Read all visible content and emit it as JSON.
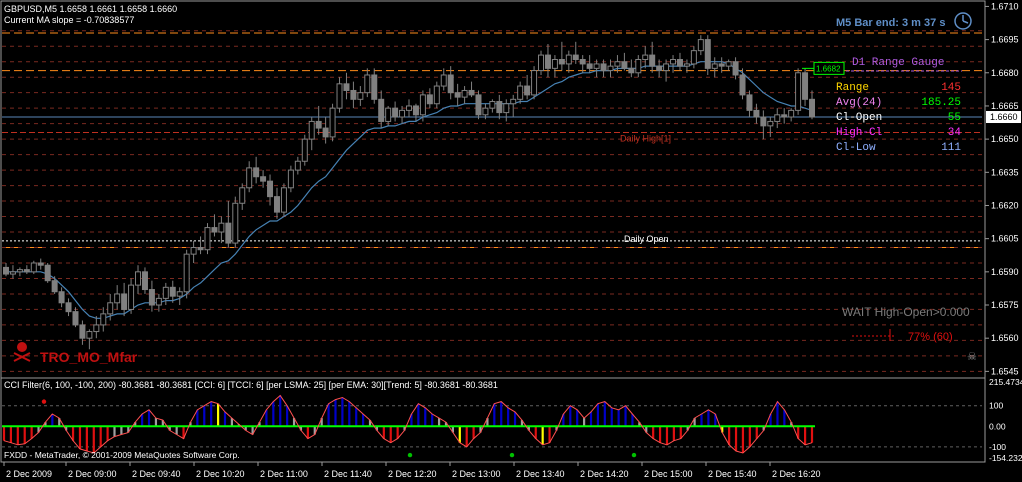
{
  "header": {
    "symbol_line": "GBPUSD,M5  1.6658 1.6661 1.6658 1.6660",
    "ma_slope": "Current MA slope = -0.70838577"
  },
  "bar_end": {
    "text": "M5 Bar end: 3 m 37 s",
    "icon": "clock-icon"
  },
  "gauge": {
    "title": "D1 Range Gauge",
    "rows": [
      {
        "label": "Range",
        "value": "145",
        "label_color": "#ffd700",
        "value_color": "#ff3030"
      },
      {
        "label": "Avg(24)",
        "value": "185.25",
        "label_color": "#ee82ee",
        "value_color": "#00ff00"
      },
      {
        "label": "Cl-Open",
        "value": "55",
        "label_color": "#ffffff",
        "value_color": "#00ff00"
      },
      {
        "label": "High-Cl",
        "value": "34",
        "label_color": "#ff30ff",
        "value_color": "#ff30ff"
      },
      {
        "label": "Cl-Low",
        "value": "111",
        "label_color": "#8fb0ff",
        "value_color": "#8fb0ff"
      }
    ]
  },
  "level_labels": {
    "daily_high": "Daily High[1]",
    "daily_open": "Daily Open",
    "price_tag": "1.6682",
    "current_price": "1.6660"
  },
  "wait_text": "WAIT High-Open>0.000",
  "progress_text": "77%  (60)",
  "brand_text": "TRO_MO_Mfar",
  "skull_icon": "skull-icon",
  "price_axis": [
    "1.6710",
    "1.6695",
    "1.6680",
    "1.6665",
    "1.6650",
    "1.6635",
    "1.6620",
    "1.6605",
    "1.6590",
    "1.6575",
    "1.6560",
    "1.6545"
  ],
  "cci": {
    "header": "CCI Filter(6, 100, -100, 200) -80.3681 -80.3681  [CCI: 6] [TCCI: 6] [per LSMA: 25] [per EMA: 30][Trend: 5] -80.3681 -80.3681",
    "axis": [
      "215.4734",
      "100",
      "0.00",
      "-100",
      "-154.2324"
    ],
    "copyright": "FXDD - MetaTrader, © 2001-2009 MetaQuotes Software Corp."
  },
  "time_axis": [
    "2 Dec 2009",
    "2 Dec 09:00",
    "2 Dec 09:40",
    "2 Dec 10:20",
    "2 Dec 11:00",
    "2 Dec 11:40",
    "2 Dec 12:20",
    "2 Dec 13:00",
    "2 Dec 13:40",
    "2 Dec 14:20",
    "2 Dec 15:00",
    "2 Dec 15:40",
    "2 Dec 16:20"
  ],
  "colors": {
    "bg": "#000000",
    "candle": "#808080",
    "ma": "#4682b4",
    "orange_dash": "#ff8c1a",
    "red_dash": "#c03020",
    "cci_up": "#0000c8",
    "cci_down": "#e01010",
    "cci_neutral": "#a0a0a0",
    "cci_yellow": "#ffff00",
    "zero_line": "#00ff00"
  },
  "chart_data": {
    "type": "candlestick",
    "symbol": "GBPUSD",
    "timeframe": "M5",
    "ohlc": [
      [
        1.6592,
        1.6594,
        1.6588,
        1.6589
      ],
      [
        1.6589,
        1.6593,
        1.6587,
        1.659
      ],
      [
        1.659,
        1.6592,
        1.6588,
        1.6591
      ],
      [
        1.6591,
        1.6593,
        1.6589,
        1.659
      ],
      [
        1.659,
        1.6595,
        1.6589,
        1.6594
      ],
      [
        1.6594,
        1.6596,
        1.6591,
        1.6593
      ],
      [
        1.6593,
        1.6594,
        1.6585,
        1.6586
      ],
      [
        1.6586,
        1.6588,
        1.658,
        1.6581
      ],
      [
        1.6581,
        1.6583,
        1.6574,
        1.6576
      ],
      [
        1.6576,
        1.6578,
        1.657,
        1.6572
      ],
      [
        1.6572,
        1.6574,
        1.6565,
        1.6566
      ],
      [
        1.6566,
        1.6568,
        1.6557,
        1.656
      ],
      [
        1.656,
        1.6564,
        1.6555,
        1.6563
      ],
      [
        1.6563,
        1.657,
        1.656,
        1.6566
      ],
      [
        1.6566,
        1.6574,
        1.6563,
        1.6571
      ],
      [
        1.6571,
        1.658,
        1.6568,
        1.6576
      ],
      [
        1.6576,
        1.6584,
        1.6573,
        1.658
      ],
      [
        1.658,
        1.6585,
        1.657,
        1.6573
      ],
      [
        1.6573,
        1.6587,
        1.6571,
        1.6584
      ],
      [
        1.6584,
        1.6593,
        1.658,
        1.659
      ],
      [
        1.659,
        1.6592,
        1.658,
        1.6582
      ],
      [
        1.6582,
        1.6586,
        1.6572,
        1.6575
      ],
      [
        1.6575,
        1.658,
        1.6572,
        1.6578
      ],
      [
        1.6578,
        1.6585,
        1.6575,
        1.6583
      ],
      [
        1.6583,
        1.6586,
        1.6576,
        1.6579
      ],
      [
        1.6579,
        1.6583,
        1.6575,
        1.6581
      ],
      [
        1.6581,
        1.66,
        1.6578,
        1.6598
      ],
      [
        1.6598,
        1.6604,
        1.6594,
        1.6601
      ],
      [
        1.6601,
        1.6606,
        1.6598,
        1.66
      ],
      [
        1.66,
        1.6612,
        1.6598,
        1.661
      ],
      [
        1.661,
        1.6616,
        1.6606,
        1.6608
      ],
      [
        1.6608,
        1.6615,
        1.6603,
        1.6612
      ],
      [
        1.6612,
        1.6622,
        1.6601,
        1.6603
      ],
      [
        1.6603,
        1.6624,
        1.6601,
        1.6621
      ],
      [
        1.6621,
        1.663,
        1.6618,
        1.6628
      ],
      [
        1.6628,
        1.664,
        1.6626,
        1.6637
      ],
      [
        1.6637,
        1.6642,
        1.663,
        1.6633
      ],
      [
        1.6633,
        1.6636,
        1.6628,
        1.6631
      ],
      [
        1.6631,
        1.6634,
        1.662,
        1.6624
      ],
      [
        1.6624,
        1.6628,
        1.6614,
        1.6617
      ],
      [
        1.6617,
        1.663,
        1.6615,
        1.6628
      ],
      [
        1.6628,
        1.6638,
        1.6626,
        1.6636
      ],
      [
        1.6636,
        1.6642,
        1.6634,
        1.664
      ],
      [
        1.664,
        1.6652,
        1.6638,
        1.665
      ],
      [
        1.665,
        1.666,
        1.6645,
        1.6658
      ],
      [
        1.6658,
        1.6665,
        1.6652,
        1.6655
      ],
      [
        1.6655,
        1.666,
        1.6648,
        1.6651
      ],
      [
        1.6651,
        1.6666,
        1.6649,
        1.6664
      ],
      [
        1.6664,
        1.6678,
        1.6662,
        1.6675
      ],
      [
        1.6675,
        1.668,
        1.6668,
        1.6672
      ],
      [
        1.6672,
        1.6676,
        1.6664,
        1.6668
      ],
      [
        1.6668,
        1.6674,
        1.6665,
        1.6671
      ],
      [
        1.6671,
        1.6682,
        1.6669,
        1.6679
      ],
      [
        1.6679,
        1.6682,
        1.6666,
        1.6668
      ],
      [
        1.6668,
        1.6672,
        1.6655,
        1.6658
      ],
      [
        1.6658,
        1.6665,
        1.6656,
        1.6664
      ],
      [
        1.6664,
        1.6667,
        1.6658,
        1.666
      ],
      [
        1.666,
        1.6665,
        1.6657,
        1.6663
      ],
      [
        1.6663,
        1.6668,
        1.666,
        1.6665
      ],
      [
        1.6665,
        1.6666,
        1.6658,
        1.6661
      ],
      [
        1.6661,
        1.6672,
        1.6658,
        1.667
      ],
      [
        1.667,
        1.6673,
        1.6664,
        1.6666
      ],
      [
        1.6666,
        1.6676,
        1.6664,
        1.6674
      ],
      [
        1.6674,
        1.6682,
        1.6672,
        1.6679
      ],
      [
        1.6679,
        1.6683,
        1.6668,
        1.6671
      ],
      [
        1.6671,
        1.6675,
        1.6665,
        1.6669
      ],
      [
        1.6669,
        1.6674,
        1.6666,
        1.6672
      ],
      [
        1.6672,
        1.6676,
        1.6669,
        1.667
      ],
      [
        1.667,
        1.6672,
        1.6659,
        1.6661
      ],
      [
        1.6661,
        1.6666,
        1.6659,
        1.6664
      ],
      [
        1.6664,
        1.6668,
        1.6662,
        1.6667
      ],
      [
        1.6667,
        1.667,
        1.6659,
        1.6662
      ],
      [
        1.6662,
        1.6668,
        1.6658,
        1.6666
      ],
      [
        1.6666,
        1.667,
        1.666,
        1.6668
      ],
      [
        1.6668,
        1.6676,
        1.6666,
        1.6674
      ],
      [
        1.6674,
        1.6679,
        1.6668,
        1.667
      ],
      [
        1.667,
        1.6683,
        1.6668,
        1.6681
      ],
      [
        1.6681,
        1.669,
        1.6679,
        1.6688
      ],
      [
        1.6688,
        1.6693,
        1.6678,
        1.6682
      ],
      [
        1.6682,
        1.6688,
        1.6678,
        1.6686
      ],
      [
        1.6686,
        1.6694,
        1.6681,
        1.6684
      ],
      [
        1.6684,
        1.669,
        1.668,
        1.6688
      ],
      [
        1.6688,
        1.6694,
        1.6684,
        1.6686
      ],
      [
        1.6686,
        1.6688,
        1.668,
        1.6684
      ],
      [
        1.6684,
        1.6688,
        1.668,
        1.6682
      ],
      [
        1.6682,
        1.6686,
        1.6678,
        1.6684
      ],
      [
        1.6684,
        1.6686,
        1.6678,
        1.6681
      ],
      [
        1.6681,
        1.6686,
        1.6678,
        1.6683
      ],
      [
        1.6683,
        1.6688,
        1.668,
        1.6685
      ],
      [
        1.6685,
        1.6689,
        1.6681,
        1.6682
      ],
      [
        1.6682,
        1.6686,
        1.6678,
        1.668
      ],
      [
        1.668,
        1.6688,
        1.6678,
        1.6686
      ],
      [
        1.6686,
        1.6692,
        1.6682,
        1.6688
      ],
      [
        1.6688,
        1.6694,
        1.668,
        1.6683
      ],
      [
        1.6683,
        1.6686,
        1.6678,
        1.6681
      ],
      [
        1.6681,
        1.6686,
        1.6676,
        1.6684
      ],
      [
        1.6684,
        1.6688,
        1.668,
        1.6686
      ],
      [
        1.6686,
        1.6689,
        1.6681,
        1.6683
      ],
      [
        1.6683,
        1.6686,
        1.668,
        1.6684
      ],
      [
        1.6684,
        1.6692,
        1.6682,
        1.669
      ],
      [
        1.669,
        1.6697,
        1.6688,
        1.6695
      ],
      [
        1.6695,
        1.6697,
        1.6679,
        1.6682
      ],
      [
        1.6682,
        1.6687,
        1.6678,
        1.6684
      ],
      [
        1.6684,
        1.6687,
        1.668,
        1.6683
      ],
      [
        1.6683,
        1.6686,
        1.6681,
        1.6685
      ],
      [
        1.6685,
        1.6687,
        1.6677,
        1.6679
      ],
      [
        1.6679,
        1.6682,
        1.6668,
        1.667
      ],
      [
        1.667,
        1.6672,
        1.666,
        1.6663
      ],
      [
        1.6663,
        1.6666,
        1.6657,
        1.666
      ],
      [
        1.666,
        1.6663,
        1.665,
        1.6656
      ],
      [
        1.6656,
        1.666,
        1.6651,
        1.6658
      ],
      [
        1.6658,
        1.6664,
        1.6655,
        1.6661
      ],
      [
        1.6661,
        1.6664,
        1.6657,
        1.666
      ],
      [
        1.666,
        1.6664,
        1.6658,
        1.6663
      ],
      [
        1.6663,
        1.6682,
        1.6661,
        1.668
      ],
      [
        1.668,
        1.6682,
        1.6665,
        1.6668
      ],
      [
        1.6668,
        1.6672,
        1.6659,
        1.666
      ]
    ],
    "ma": [
      1.659,
      1.659,
      1.659,
      1.659,
      1.659,
      1.659,
      1.6589,
      1.6587,
      1.6584,
      1.6581,
      1.6577,
      1.6573,
      1.657,
      1.6569,
      1.6569,
      1.657,
      1.6571,
      1.6571,
      1.6573,
      1.6575,
      1.6576,
      1.6576,
      1.6576,
      1.6577,
      1.6577,
      1.6578,
      1.658,
      1.6583,
      1.6585,
      1.6588,
      1.6591,
      1.6594,
      1.6595,
      1.6598,
      1.6602,
      1.6606,
      1.6609,
      1.6611,
      1.6613,
      1.6613,
      1.6615,
      1.6617,
      1.662,
      1.6624,
      1.6628,
      1.6631,
      1.6633,
      1.6637,
      1.6641,
      1.6645,
      1.6648,
      1.6651,
      1.6654,
      1.6655,
      1.6655,
      1.6656,
      1.6656,
      1.6657,
      1.6658,
      1.6658,
      1.666,
      1.6661,
      1.6662,
      1.6664,
      1.6665,
      1.6665,
      1.6666,
      1.6666,
      1.6666,
      1.6666,
      1.6666,
      1.6666,
      1.6666,
      1.6666,
      1.6667,
      1.6667,
      1.6669,
      1.6671,
      1.6673,
      1.6675,
      1.6676,
      1.6678,
      1.6679,
      1.668,
      1.668,
      1.6681,
      1.6681,
      1.6681,
      1.6682,
      1.6682,
      1.6682,
      1.6682,
      1.6683,
      1.6683,
      1.6683,
      1.6683,
      1.6683,
      1.6683,
      1.6683,
      1.6684,
      1.6685,
      1.6685,
      1.6685,
      1.6685,
      1.6684,
      1.6682,
      1.668,
      1.6677,
      1.6674,
      1.6671,
      1.6669,
      1.6667,
      1.6666,
      1.6665,
      1.6665,
      1.6664,
      1.6663
    ],
    "levels": {
      "orange": [
        1.6698,
        1.6681,
        1.6601
      ],
      "daily_high_1": 1.6653,
      "daily_open": 1.6604,
      "current": 1.666,
      "marker": 1.6682
    },
    "ylim": [
      1.6542,
      1.6712
    ],
    "cci_values": [
      -70,
      -80,
      -90,
      -85,
      -60,
      -30,
      20,
      60,
      40,
      -20,
      -70,
      -110,
      -120,
      -130,
      -100,
      -70,
      -50,
      -40,
      -30,
      20,
      60,
      80,
      40,
      30,
      -20,
      -40,
      -60,
      20,
      80,
      100,
      120,
      110,
      70,
      40,
      10,
      -20,
      -40,
      20,
      80,
      120,
      150,
      100,
      40,
      -20,
      -60,
      -40,
      40,
      110,
      130,
      140,
      120,
      90,
      60,
      30,
      -20,
      -60,
      -80,
      -60,
      -20,
      60,
      110,
      90,
      60,
      40,
      20,
      -30,
      -80,
      -100,
      -60,
      -30,
      40,
      110,
      120,
      90,
      70,
      30,
      -20,
      -60,
      -90,
      -80,
      -20,
      60,
      100,
      80,
      40,
      70,
      110,
      120,
      90,
      80,
      100,
      60,
      20,
      -30,
      -60,
      -80,
      -90,
      -70,
      -60,
      -20,
      40,
      60,
      80,
      60,
      -30,
      -90,
      -120,
      -130,
      -100,
      -60,
      -20,
      60,
      120,
      80,
      20,
      -60,
      -90,
      -80
    ],
    "cci_ylim": [
      -154.2324,
      215.4734
    ]
  }
}
